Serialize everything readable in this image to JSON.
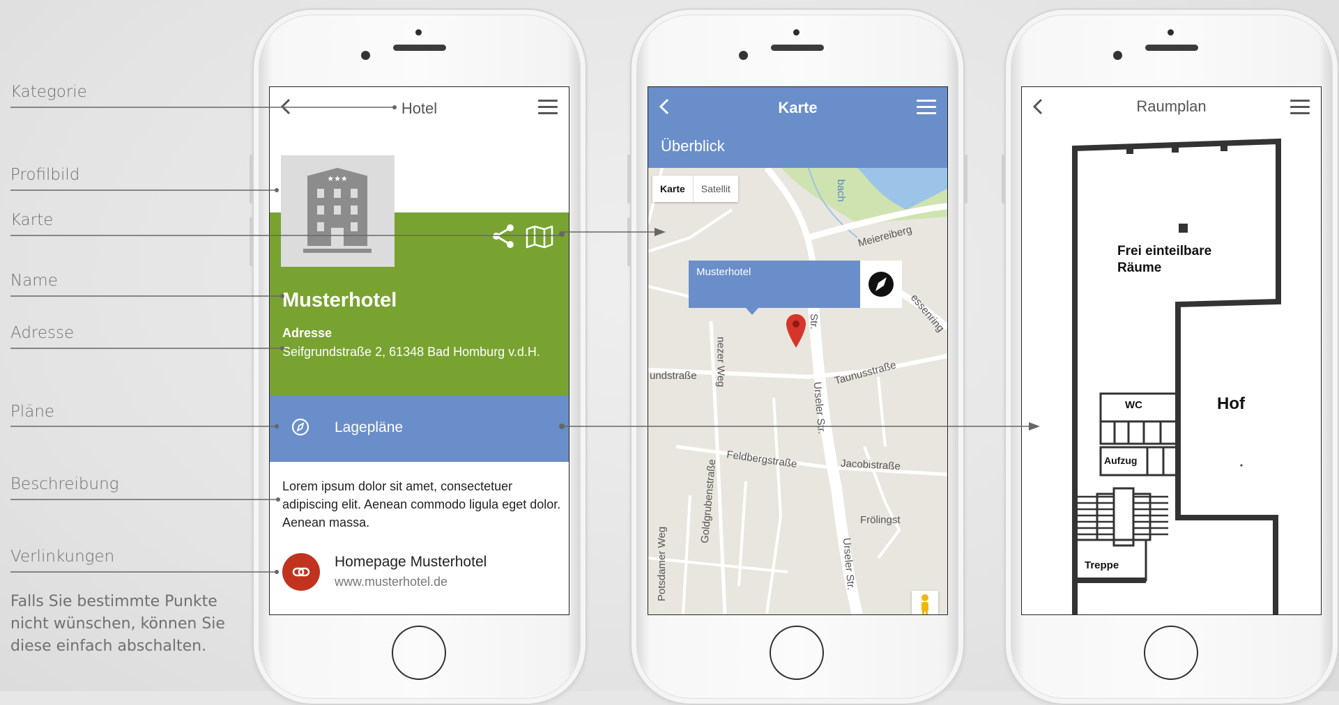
{
  "annotations": {
    "category": "Kategorie",
    "profile_image": "Profilbild",
    "map": "Karte",
    "name": "Name",
    "address": "Adresse",
    "plans": "Pläne",
    "description": "Beschreibung",
    "links": "Verlinkungen",
    "note": "Falls Sie bestimmte Punkte nicht wünschen, können Sie diese einfach abschalten."
  },
  "screen_detail": {
    "title": "Hotel",
    "hotel_name": "Musterhotel",
    "address_heading": "Adresse",
    "address_text": "Seifgrundstraße 2, 61348 Bad Homburg v.d.H.",
    "plans_label": "Lagepläne",
    "description": "Lorem ipsum dolor sit amet, consectetuer adipiscing elit. Aenean commodo ligula eget dolor. Aenean massa.",
    "link_title": "Homepage Musterhotel",
    "link_url": "www.musterhotel.de",
    "colors": {
      "green": "#78a330",
      "blue": "#6a8ec9",
      "link_red": "#c2331f"
    }
  },
  "screen_map": {
    "title": "Karte",
    "subtitle": "Überblick",
    "map_type_options": [
      "Karte",
      "Satellit"
    ],
    "map_type_selected": "Karte",
    "marker_label": "Musterhotel",
    "zoom_in": "+",
    "zoom_out": "−",
    "street_labels": {
      "meiereiberg": "Meiereiberg",
      "bach": "bach",
      "essenring": "essenring",
      "mainzer_weg": "nezer Weg",
      "str_top": "Str.",
      "taunus": "Taunusstraße",
      "undstrasse": "undstraße",
      "urseler1": "Urseler Str.",
      "feldberg": "Feldbergstraße",
      "jacobi": "Jacobistraße",
      "goldgruben": "Goldgrubenstraße",
      "potsdamer": "Potsdamer Weg",
      "froelingst": "Frölingst",
      "urseler2": "Urseler Str."
    }
  },
  "screen_plan": {
    "title": "Raumplan",
    "labels": {
      "rooms": "Frei einteilbare Räume",
      "wc": "WC",
      "courtyard": "Hof",
      "elevator": "Aufzug",
      "stairs": "Treppe"
    }
  },
  "icons": [
    "back-chevron-icon",
    "hamburger-menu-icon",
    "share-icon",
    "map-icon",
    "compass-icon",
    "link-icon",
    "pegman-icon",
    "map-marker-icon"
  ]
}
